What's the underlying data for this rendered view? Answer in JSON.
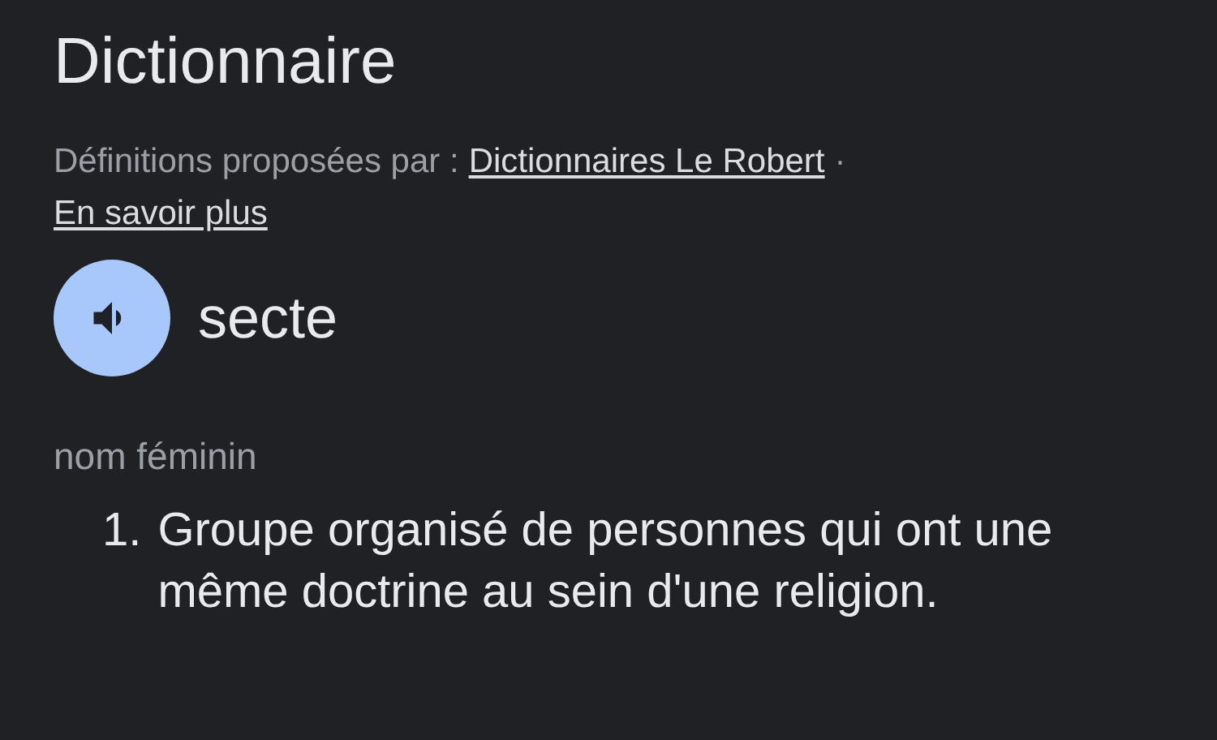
{
  "header": {
    "title": "Dictionnaire",
    "source_prefix": "Définitions proposées par :",
    "source_link": "Dictionnaires Le Robert",
    "separator": "·",
    "more_link": "En savoir plus"
  },
  "entry": {
    "word": "secte",
    "part_of_speech": "nom féminin",
    "definitions": [
      {
        "number": "1.",
        "text": "Groupe organisé de personnes qui ont une même doctrine au sein d'une religion."
      }
    ]
  }
}
